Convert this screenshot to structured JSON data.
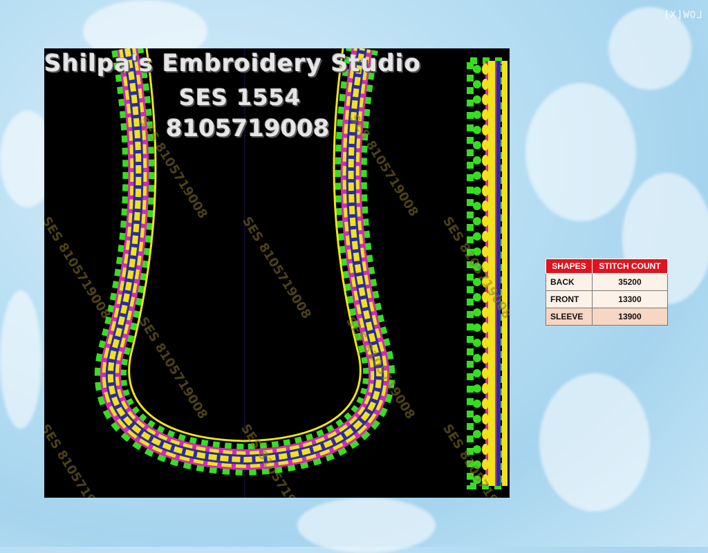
{
  "corner_mark": "LOW[X]",
  "design": {
    "title": "Shilpa's Embroidery Studio",
    "code": "SES 1554",
    "phone": "8105719008",
    "watermark": "SES 8105719008"
  },
  "colors": {
    "yellow": "#f2e21a",
    "blue": "#2a2aa8",
    "magenta": "#d22ab8",
    "green": "#34e01e",
    "background": "#000000"
  },
  "stitch_table": {
    "headers": [
      "SHAPES",
      "STITCH COUNT"
    ],
    "rows": [
      {
        "shape": "BACK",
        "count": "35200"
      },
      {
        "shape": "FRONT",
        "count": "13300"
      },
      {
        "shape": "SLEEVE",
        "count": "13900"
      }
    ]
  }
}
